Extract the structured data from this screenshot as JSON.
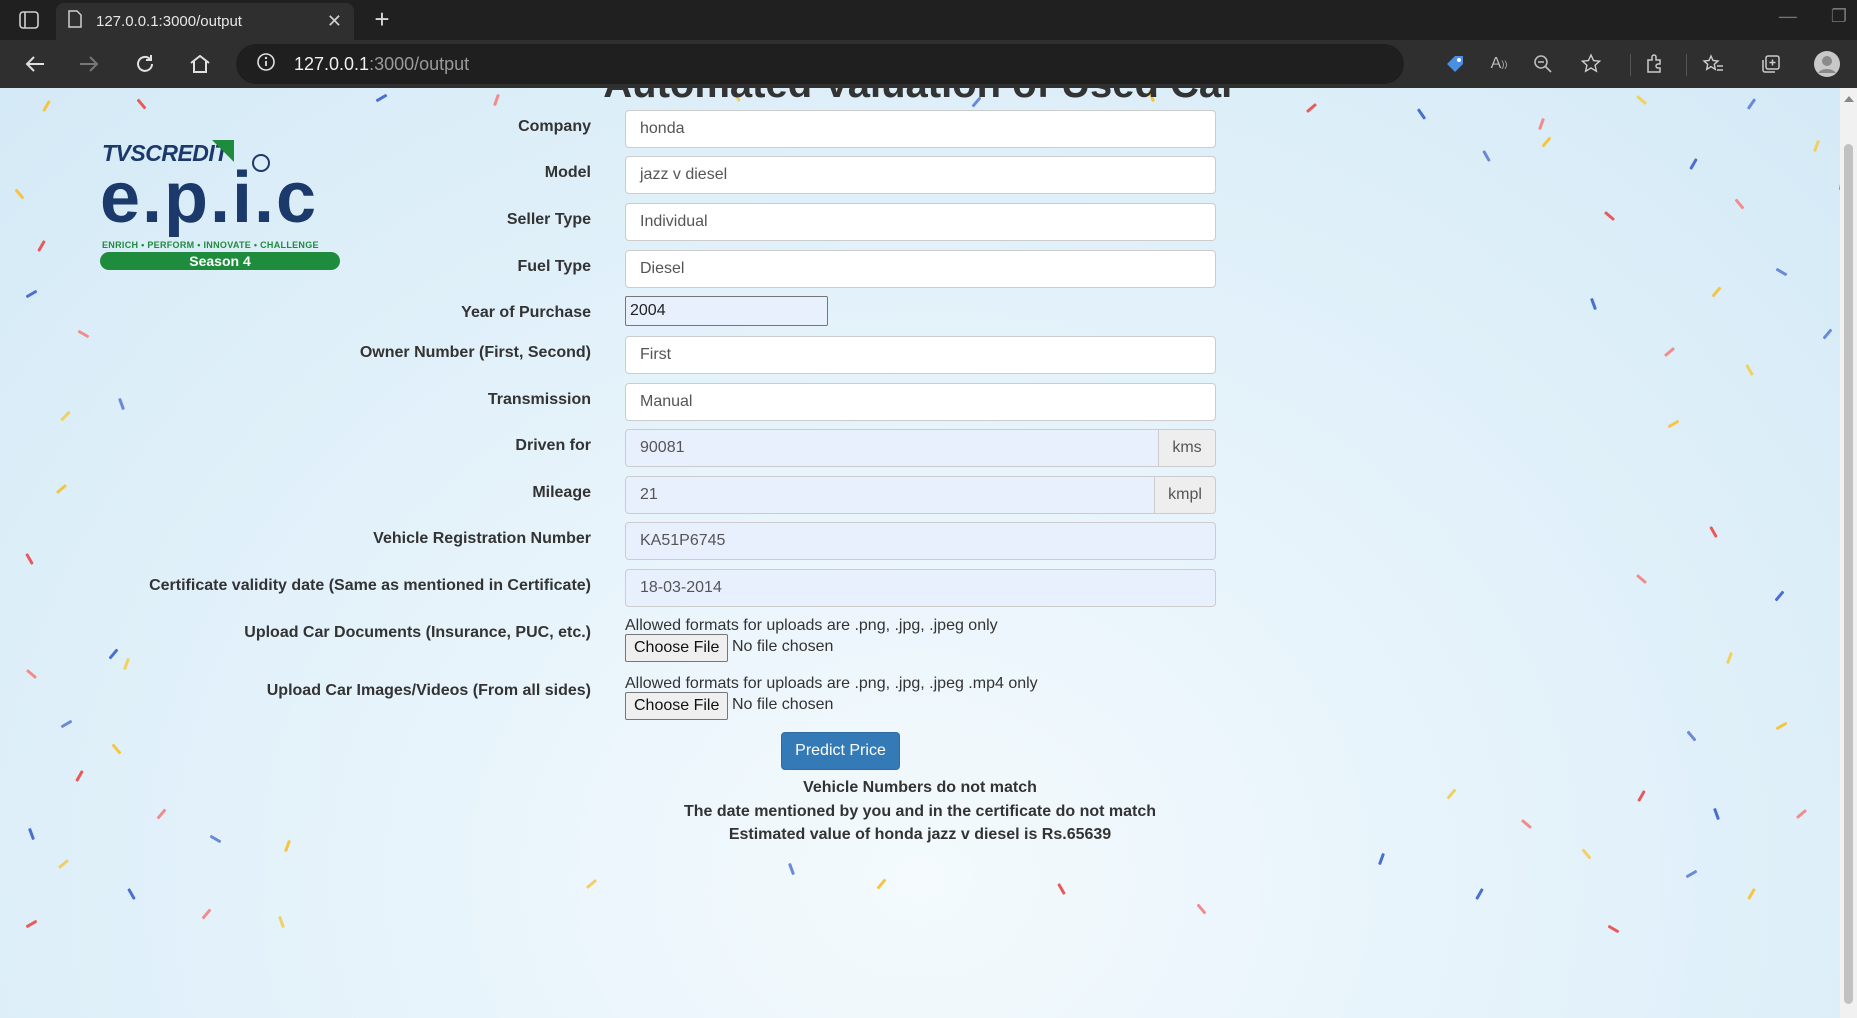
{
  "browser": {
    "tab_title": "127.0.0.1:3000/output",
    "url_host": "127.0.0.1",
    "url_rest": ":3000/output"
  },
  "page": {
    "title": "Automated Valuation of Used Car"
  },
  "logo": {
    "brand": "TVS",
    "brand2": "CREDIT",
    "big": "e.p.i.c",
    "tagline": "ENRICH • PERFORM • INNOVATE • CHALLENGE",
    "season": "Season 4"
  },
  "form": {
    "company": {
      "label": "Company",
      "value": "honda"
    },
    "model": {
      "label": "Model",
      "value": "jazz v diesel"
    },
    "seller_type": {
      "label": "Seller Type",
      "value": "Individual"
    },
    "fuel_type": {
      "label": "Fuel Type",
      "value": "Diesel"
    },
    "year": {
      "label": "Year of Purchase",
      "value": "2004"
    },
    "owner": {
      "label": "Owner Number (First, Second)",
      "value": "First"
    },
    "transmission": {
      "label": "Transmission",
      "value": "Manual"
    },
    "driven": {
      "label": "Driven for",
      "value": "90081",
      "unit": "kms"
    },
    "mileage": {
      "label": "Mileage",
      "value": "21",
      "unit": "kmpl"
    },
    "reg_number": {
      "label": "Vehicle Registration Number",
      "value": "KA51P6745"
    },
    "cert_date": {
      "label": "Certificate validity date (Same as mentioned in Certificate)",
      "value": "18-03-2014"
    },
    "docs": {
      "label": "Upload Car Documents (Insurance, PUC, etc.)",
      "note": "Allowed formats for uploads are .png, .jpg, .jpeg only",
      "button": "Choose File",
      "status": "No file chosen"
    },
    "images": {
      "label": "Upload Car Images/Videos (From all sides)",
      "note": "Allowed formats for uploads are .png, .jpg, .jpeg .mp4 only",
      "button": "Choose File",
      "status": "No file chosen"
    },
    "predict_label": "Predict Price"
  },
  "results": [
    "Vehicle Numbers do not match",
    "The date mentioned by you and in the certificate do not match",
    "Estimated value of honda jazz v diesel is Rs.65639"
  ]
}
